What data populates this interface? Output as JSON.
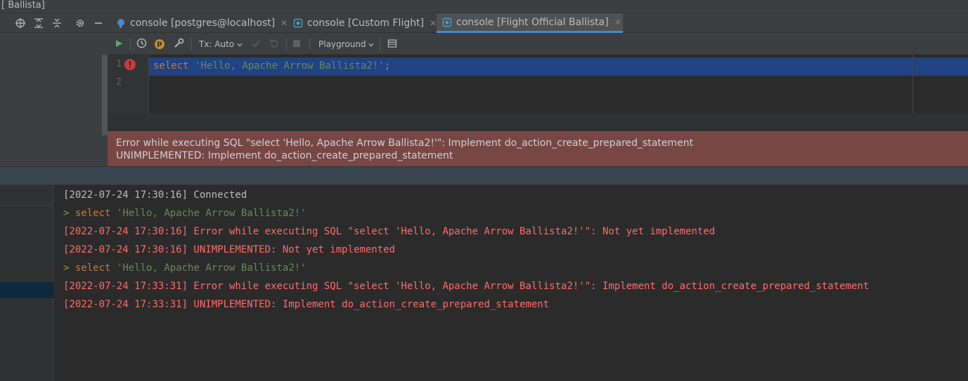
{
  "window": {
    "title_fragment": "[ Ballista]"
  },
  "colors": {
    "accent": "#4a88c7",
    "error_banner": "#784645",
    "error_text": "#ff6b68",
    "keyword": "#cc7832",
    "string": "#6a8759",
    "selection": "#214283"
  },
  "tabs": [
    {
      "label": "console [postgres@localhost]",
      "icon": "postgres-elephant-icon",
      "close": "✕",
      "active": false
    },
    {
      "label": "console [Custom Flight]",
      "icon": "flight-datasource-icon",
      "close": "✕",
      "active": false
    },
    {
      "label": "console [Flight Official Ballista]",
      "icon": "flight-datasource-icon",
      "close": "✕",
      "active": true
    }
  ],
  "toolbar": {
    "tx_label": "Tx: Auto",
    "schema_label": "Playground",
    "badge": "p"
  },
  "editor": {
    "line_numbers": [
      "1",
      "2"
    ],
    "code": {
      "keyword": "select",
      "string": "'Hello, Apache Arrow Ballista2!'",
      "terminator": ";"
    }
  },
  "error_banner": {
    "line1": "Error while executing SQL \"select 'Hello, Apache Arrow Ballista2!'\": Implement do_action_create_prepared_statement",
    "line2": "UNIMPLEMENTED: Implement do_action_create_prepared_statement"
  },
  "output": {
    "lines": [
      {
        "kind": "normal",
        "text": "[2022-07-24 17:30:16] Connected"
      },
      {
        "kind": "prompt",
        "prompt": ">",
        "keyword": "select",
        "string": "'Hello, Apache Arrow Ballista2!'"
      },
      {
        "kind": "error",
        "text": "[2022-07-24 17:30:16] Error while executing SQL \"select 'Hello, Apache Arrow Ballista2!'\": Not yet implemented"
      },
      {
        "kind": "error",
        "text": "[2022-07-24 17:30:16] UNIMPLEMENTED: Not yet implemented"
      },
      {
        "kind": "prompt",
        "prompt": ">",
        "keyword": "select",
        "string": "'Hello, Apache Arrow Ballista2!'"
      },
      {
        "kind": "error",
        "text": "[2022-07-24 17:33:31] Error while executing SQL \"select 'Hello, Apache Arrow Ballista2!'\": Implement do_action_create_prepared_statement"
      },
      {
        "kind": "error",
        "text": "[2022-07-24 17:33:31] UNIMPLEMENTED: Implement do_action_create_prepared_statement"
      }
    ]
  }
}
